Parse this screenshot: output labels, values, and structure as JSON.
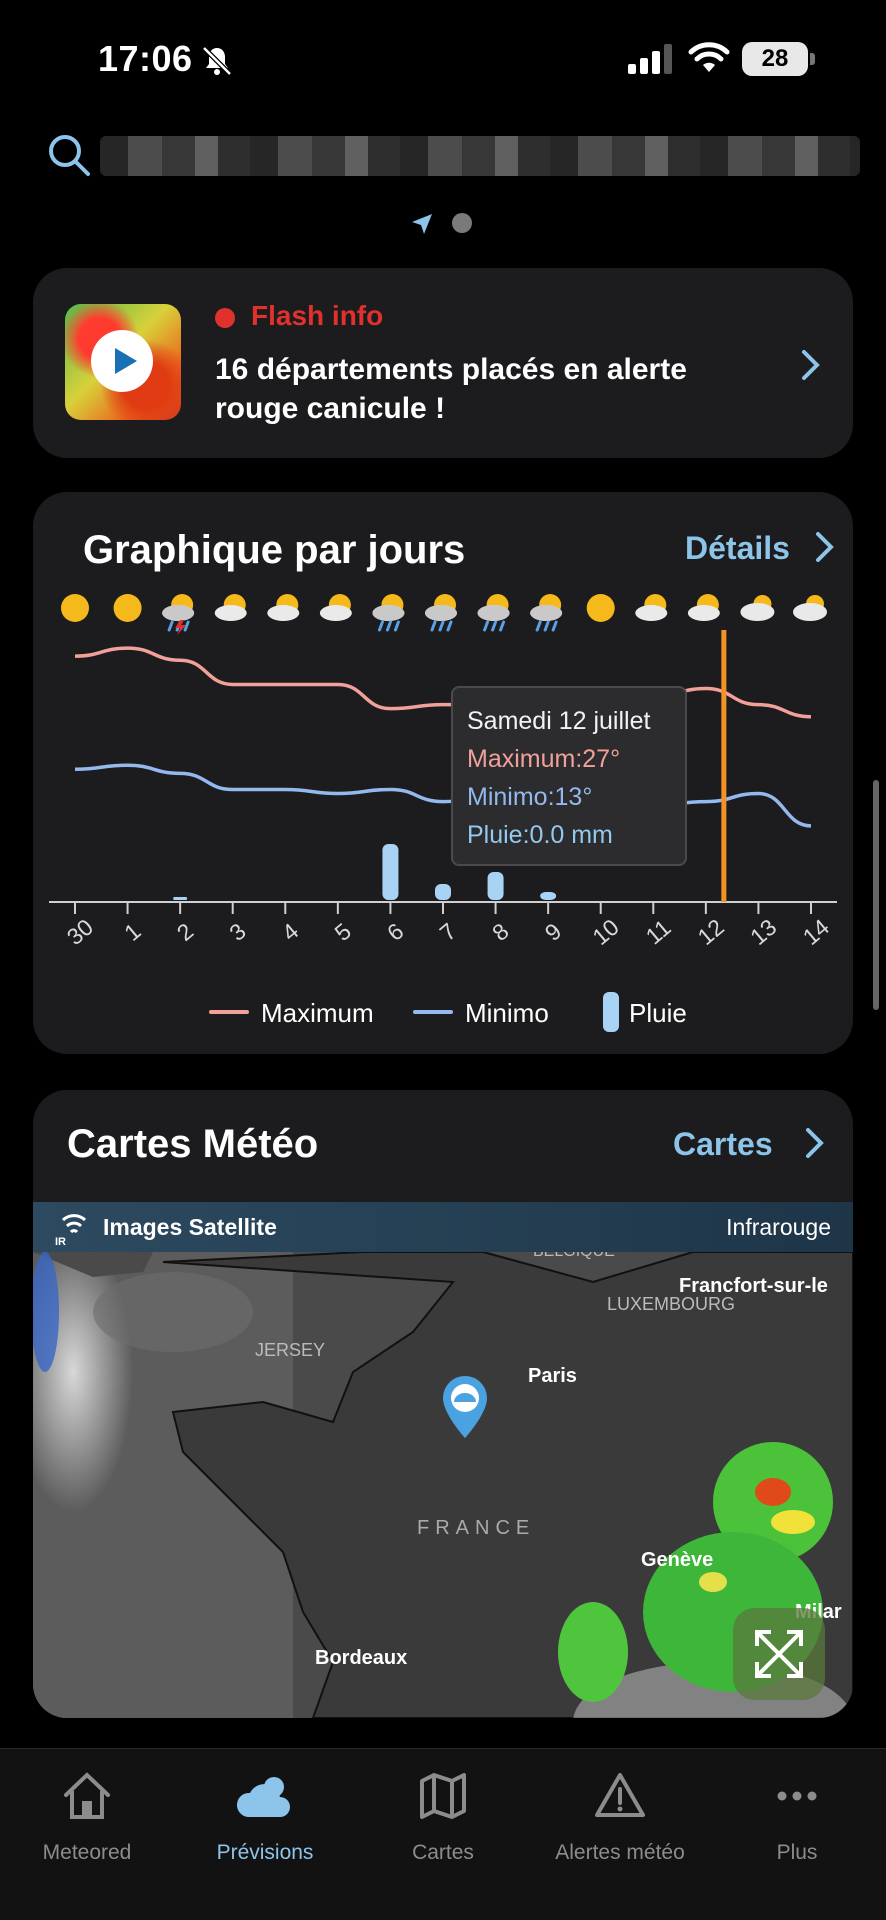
{
  "status_bar": {
    "time": "17:06",
    "battery": "28"
  },
  "search": {
    "placeholder": ""
  },
  "flash": {
    "tag": "Flash info",
    "headline": "16 départements placés en alerte rouge canicule !"
  },
  "graph_card": {
    "title": "Graphique par jours",
    "details_label": "Détails",
    "tooltip": {
      "date": "Samedi 12 juillet",
      "max": "Maximum:27°",
      "min": "Minimo:13°",
      "rain": "Pluie:0.0 mm"
    },
    "legend": {
      "max": "Maximum",
      "min": "Minimo",
      "rain": "Pluie"
    },
    "icons": [
      "sun",
      "sun",
      "storm",
      "partly-cloudy",
      "partly-cloudy",
      "partly-cloudy",
      "rain",
      "rain",
      "rain",
      "rain",
      "sun",
      "partly-cloudy",
      "partly-cloudy",
      "cloudy",
      "cloudy"
    ]
  },
  "chart_data": {
    "type": "line",
    "x": [
      "30",
      "1",
      "2",
      "3",
      "4",
      "5",
      "6",
      "7",
      "8",
      "9",
      "10",
      "11",
      "12",
      "13",
      "14"
    ],
    "series": [
      {
        "name": "Maximum",
        "values": [
          31,
          32,
          30.5,
          27.5,
          27.5,
          27.5,
          24.5,
          25,
          25,
          25,
          25.5,
          26,
          27,
          25,
          23.5
        ],
        "color": "#f2a09a"
      },
      {
        "name": "Minimo",
        "values": [
          17,
          17.5,
          16.5,
          14.5,
          14.5,
          14,
          14.5,
          13,
          13.5,
          13,
          13,
          12.5,
          13,
          14,
          10
        ],
        "color": "#93b9ee"
      },
      {
        "name": "Pluie",
        "type": "bar",
        "values": [
          0,
          0,
          0.1,
          0,
          0,
          0,
          2.8,
          0.8,
          1.4,
          0.4,
          0,
          0,
          0,
          0,
          0
        ],
        "color": "#a8d3f5"
      }
    ],
    "highlight_x": "12",
    "xlabel": "",
    "ylabel": ""
  },
  "maps_card": {
    "title": "Cartes Météo",
    "link_label": "Cartes",
    "bar_label": "Images Satellite",
    "sat_badge": "IR",
    "mode": "Infrarouge",
    "places": {
      "jersey": "JERSEY",
      "paris": "Paris",
      "luxembourg": "LUXEMBOURG",
      "francfort": "Francfort-sur-le",
      "france": "FRANCE",
      "geneve": "Genève",
      "bordeaux": "Bordeaux",
      "milan": "Milar",
      "belgique": "BELGIQUE"
    }
  },
  "tabs": [
    {
      "label": "Meteored",
      "icon": "home-icon"
    },
    {
      "label": "Prévisions",
      "icon": "cloud-sun-icon",
      "active": true
    },
    {
      "label": "Cartes",
      "icon": "map-icon"
    },
    {
      "label": "Alertes météo",
      "icon": "warning-icon"
    },
    {
      "label": "Plus",
      "icon": "more-icon"
    }
  ]
}
